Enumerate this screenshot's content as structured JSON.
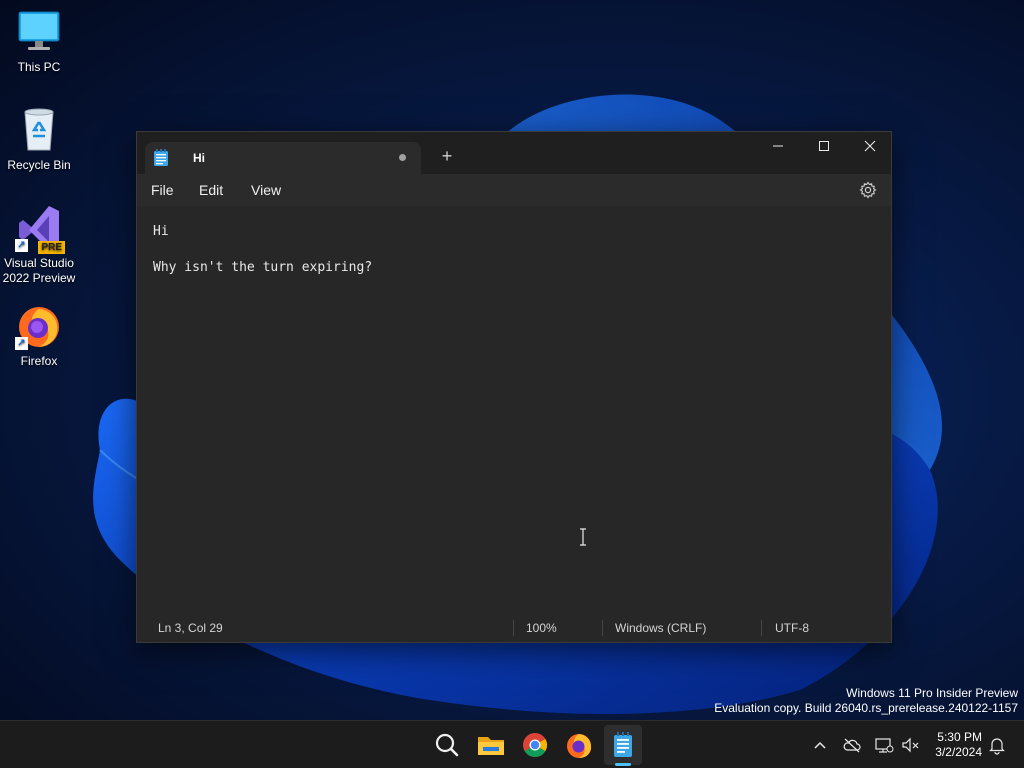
{
  "desktop": {
    "icons": [
      {
        "label": "This PC",
        "icon": "monitor-icon"
      },
      {
        "label": "Recycle Bin",
        "icon": "recycle-bin-icon"
      },
      {
        "label": "Visual Studio\n2022 Preview",
        "label_line1": "Visual Studio",
        "label_line2": "2022 Preview",
        "badge": "PRE",
        "icon": "visual-studio-icon"
      },
      {
        "label": "Firefox",
        "icon": "firefox-icon"
      }
    ]
  },
  "window": {
    "tab_title": "Hi",
    "tab_unsaved": true,
    "new_tab_symbol": "+",
    "menu": [
      "File",
      "Edit",
      "View"
    ],
    "content_lines": [
      "Hi",
      "",
      "Why isn't the turn expiring?"
    ],
    "status": {
      "position": "Ln 3, Col 29",
      "zoom": "100%",
      "line_ending": "Windows (CRLF)",
      "encoding": "UTF-8"
    }
  },
  "watermark": {
    "line1": "Windows 11 Pro Insider Preview",
    "line2": "Evaluation copy. Build 26040.rs_prerelease.240122-1157"
  },
  "taskbar": {
    "apps": [
      "search-icon",
      "file-explorer-icon",
      "chrome-icon",
      "firefox-icon",
      "notepad-icon"
    ],
    "tray": [
      "chevron-up-icon",
      "onedrive-offline-icon",
      "network-icon",
      "volume-muted-icon",
      "notification-bell-icon"
    ],
    "time": "5:30 PM",
    "date": "3/2/2024"
  },
  "colors": {
    "accent": "#4cc2ff",
    "window_bg": "#272727",
    "titlebar_bg": "#1f1f1f",
    "taskbar_bg": "#1c1c1c"
  }
}
